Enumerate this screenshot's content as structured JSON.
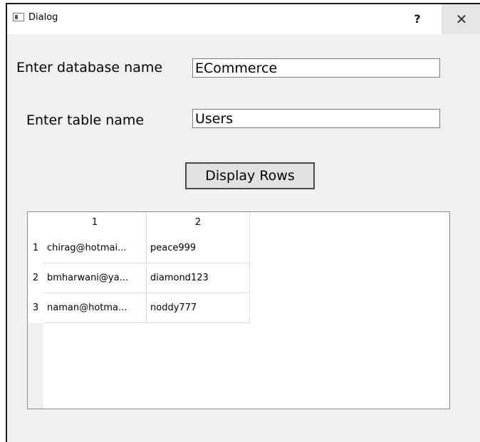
{
  "window": {
    "title": "Dialog",
    "help_glyph": "?",
    "close_glyph": "✕"
  },
  "form": {
    "database_label": "Enter database name",
    "database_value": "ECommerce",
    "table_label": "Enter table name",
    "table_value": "Users",
    "display_button": "Display Rows"
  },
  "table": {
    "columns": [
      "1",
      "2"
    ],
    "row_headers": [
      "1",
      "2",
      "3"
    ],
    "rows": [
      [
        "chirag@hotmai...",
        "peace999"
      ],
      [
        "bmharwani@ya...",
        "diamond123"
      ],
      [
        "naman@hotma...",
        "noddy777"
      ]
    ]
  }
}
